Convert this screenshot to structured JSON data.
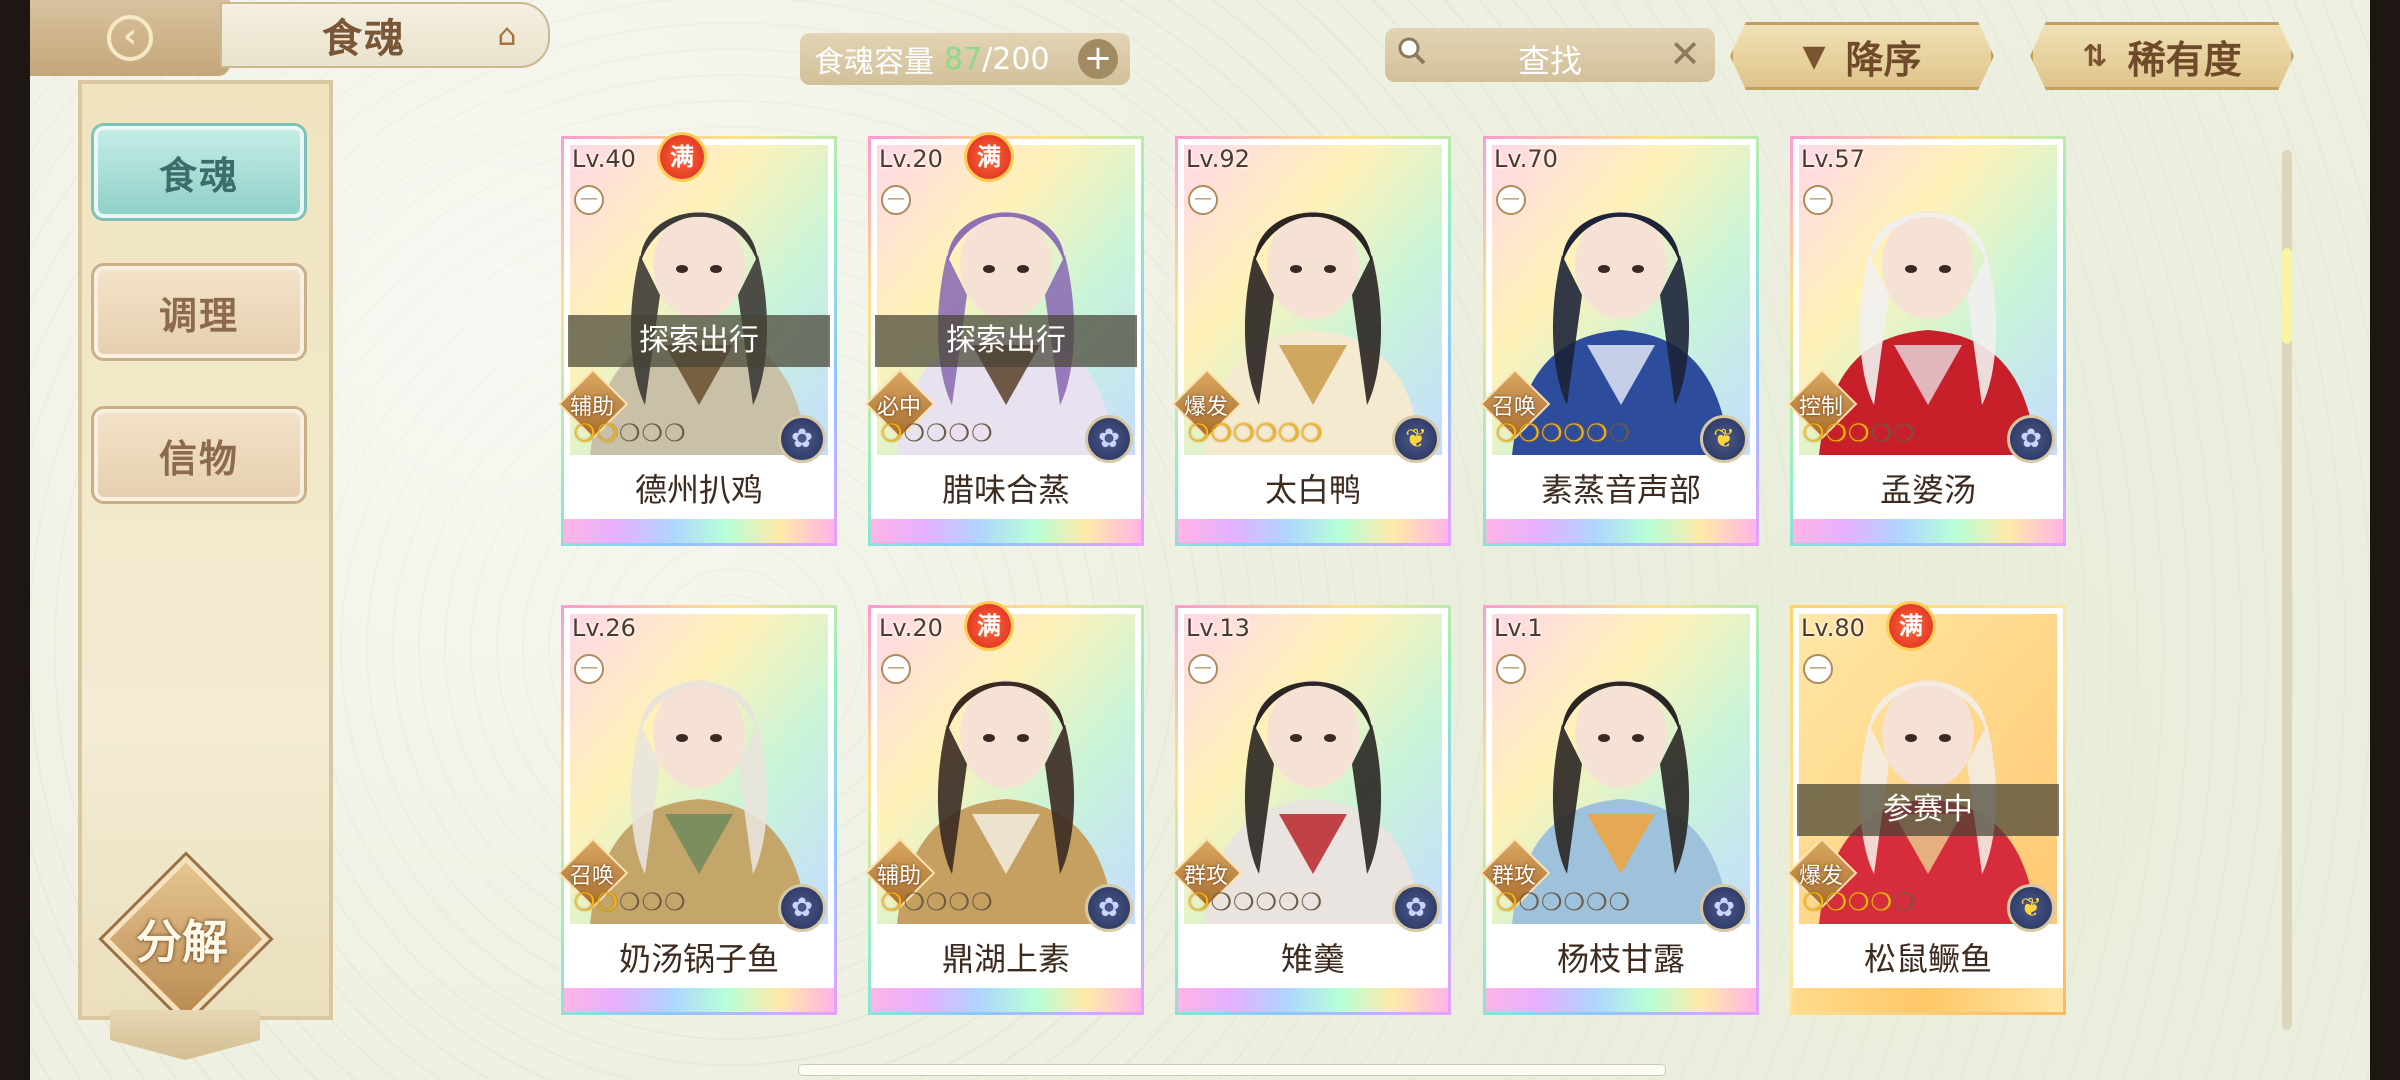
{
  "header": {
    "title": "食魂",
    "back_icon": "back-arrow-icon",
    "home_icon": "palace-icon"
  },
  "sidebar": {
    "tabs": [
      {
        "label": "食魂",
        "active": true
      },
      {
        "label": "调理",
        "active": false
      },
      {
        "label": "信物",
        "active": false
      }
    ],
    "decompose_label": "分解"
  },
  "topbar": {
    "capacity_label": "食魂容量",
    "capacity_current": "87",
    "capacity_max": "/200",
    "add_label": "+",
    "search_placeholder": "查找",
    "clear_label": "✕",
    "sort_order_label": "降序",
    "sort_key_label": "稀有度"
  },
  "cards": [
    {
      "level": "Lv.40",
      "full": "满",
      "status": "探索出行",
      "role": "辅助",
      "stars": 2,
      "element": "flower",
      "name": "德州扒鸡",
      "palette": [
        "#3c3a36",
        "#c9c0a8",
        "#6a4e2e"
      ],
      "gold": false
    },
    {
      "level": "Lv.20",
      "full": "满",
      "status": "探索出行",
      "role": "必中",
      "stars": 1,
      "element": "flower",
      "name": "腊味合蒸",
      "palette": [
        "#8d6fb3",
        "#e8e2f0",
        "#5a3f2c"
      ],
      "gold": false
    },
    {
      "level": "Lv.92",
      "full": "",
      "status": "",
      "role": "爆发",
      "stars": 6,
      "element": "leaf",
      "name": "太白鸭",
      "palette": [
        "#2a2422",
        "#f4ead0",
        "#c89b4a"
      ],
      "gold": false
    },
    {
      "level": "Lv.70",
      "full": "",
      "status": "",
      "role": "召唤",
      "stars": 5,
      "element": "leaf",
      "name": "素蒸音声部",
      "palette": [
        "#1d2338",
        "#2e4c9c",
        "#dfe6f4"
      ],
      "gold": false
    },
    {
      "level": "Lv.57",
      "full": "",
      "status": "",
      "role": "控制",
      "stars": 3,
      "element": "flower",
      "name": "孟婆汤",
      "palette": [
        "#f2eff0",
        "#c8202a",
        "#e6d2d6"
      ],
      "gold": false
    },
    {
      "level": "Lv.26",
      "full": "",
      "status": "",
      "role": "召唤",
      "stars": 2,
      "element": "flower",
      "name": "奶汤锅子鱼",
      "palette": [
        "#e8e4dc",
        "#c5a66a",
        "#6f8a5c"
      ],
      "gold": false
    },
    {
      "level": "Lv.20",
      "full": "满",
      "status": "",
      "role": "辅助",
      "stars": 1,
      "element": "flower",
      "name": "鼎湖上素",
      "palette": [
        "#3a2a22",
        "#c6a060",
        "#f2ede0"
      ],
      "gold": false
    },
    {
      "level": "Lv.13",
      "full": "",
      "status": "",
      "role": "群攻",
      "stars": 1,
      "element": "flower",
      "name": "雉羹",
      "palette": [
        "#2a2624",
        "#e9e4e0",
        "#b8262c"
      ],
      "gold": false
    },
    {
      "level": "Lv.1",
      "full": "",
      "status": "",
      "role": "群攻",
      "stars": 1,
      "element": "flower",
      "name": "杨枝甘露",
      "palette": [
        "#2a2624",
        "#9fc2dc",
        "#f0a43a"
      ],
      "gold": false
    },
    {
      "level": "Lv.80",
      "full": "满",
      "status": "参赛中",
      "role": "爆发",
      "stars": 4,
      "element": "leaf",
      "name": "松鼠鳜鱼",
      "palette": [
        "#f4ece2",
        "#d62c3c",
        "#e9c88a"
      ],
      "gold": true
    }
  ]
}
